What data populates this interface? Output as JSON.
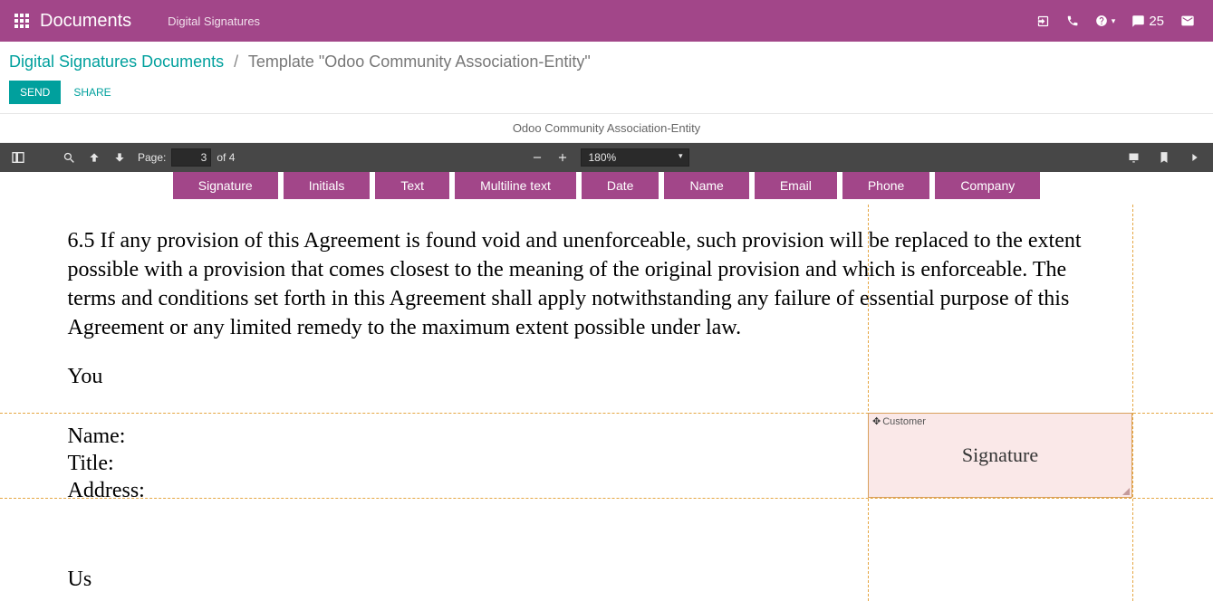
{
  "header": {
    "app_title": "Documents",
    "sub_nav": "Digital Signatures",
    "conversations_count": "25"
  },
  "breadcrumb": {
    "parent": "Digital Signatures Documents",
    "current": "Template \"Odoo Community Association-Entity\""
  },
  "actions": {
    "send": "SEND",
    "share": "SHARE"
  },
  "doc_title": "Odoo Community Association-Entity",
  "pdf_toolbar": {
    "page_label": "Page:",
    "page_current": "3",
    "page_total": "of 4",
    "zoom": "180%"
  },
  "field_tabs": [
    "Signature",
    "Initials",
    "Text",
    "Multiline text",
    "Date",
    "Name",
    "Email",
    "Phone",
    "Company"
  ],
  "document": {
    "para": "6.5 If any provision of this Agreement is found void and unenforceable, such provision will be replaced to the extent possible with a provision that comes closest to the meaning of the original provision and which is enforceable.  The terms and conditions set forth in this Agreement shall apply notwithstanding any failure of essential purpose of this Agreement or any limited remedy to the maximum extent possible under law.",
    "you_label": "You",
    "name_label": "Name:",
    "title_label": "Title:",
    "address_label": "Address:",
    "us_label": "Us"
  },
  "sig_field": {
    "role": "Customer",
    "label": "Signature"
  }
}
